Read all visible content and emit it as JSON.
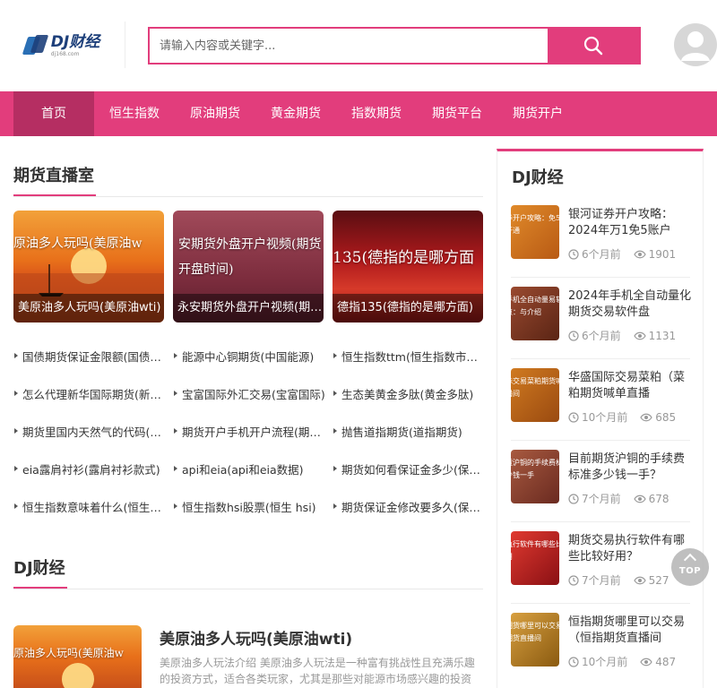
{
  "brand": {
    "logo_text": "DJ财经",
    "logo_sub": "dj168.com"
  },
  "search": {
    "placeholder": "请输入内容或关键字..."
  },
  "nav": [
    {
      "label": "首页",
      "active": true
    },
    {
      "label": "恒生指数"
    },
    {
      "label": "原油期货"
    },
    {
      "label": "黄金期货"
    },
    {
      "label": "指数期货"
    },
    {
      "label": "期货平台"
    },
    {
      "label": "期货开户"
    }
  ],
  "live": {
    "title": "期货直播室",
    "cards": [
      {
        "image_text": "原油多人玩吗(美原油w",
        "caption": "美原油多人玩吗(美原油wti)"
      },
      {
        "image_text": "安期货外盘开户视频(期货开盘时间)",
        "caption": "永安期货外盘开户视频(期货开盘时间)"
      },
      {
        "image_text": "135(德指的是哪方面",
        "caption": "德指135(德指的是哪方面)"
      }
    ],
    "links": [
      [
        "国债期货保证金限额(国债期货保证金)",
        "能源中心铜期货(中国能源)",
        "恒生指数ttm(恒生指数市盈率)"
      ],
      [
        "怎么代理新华国际期货(新华国际)",
        "宝富国际外汇交易(宝富国际)",
        "生态美黄金多肽(黄金多肽)"
      ],
      [
        "期货里国内天然气的代码(天然气)",
        "期货开户手机开户流程(期货开户)",
        "抛售道指期货(道指期货)"
      ],
      [
        "eia露肩衬衫(露肩衬衫款式)",
        "api和eia(api和eia数据)",
        "期货如何看保证金多少(保证金)"
      ],
      [
        "恒生指数意味着什么(恒生指数)",
        "恒生指数hsi股票(恒生 hsi)",
        "期货保证金修改要多久(保证金)"
      ]
    ]
  },
  "dj": {
    "title": "DJ财经",
    "featured": {
      "image_text": "原油多人玩吗(美原油w",
      "title": "美原油多人玩吗(美原油wti)",
      "desc": "美原油多人玩法介绍 美原油多人玩法是一种富有挑战性且充满乐趣的投资方式，适合各类玩家，尤其是那些对能源市场感兴趣的投资者。"
    }
  },
  "sidebar": {
    "title": "DJ财经",
    "items": [
      {
        "thumb_text": "券开户攻略：免5账户开通",
        "title": "银河证券开户攻略：2024年万1免5账户",
        "time": "6个月前",
        "views": "1901",
        "color": "#c8681a"
      },
      {
        "thumb_text": "手机全自动量易软件盘点：与介绍",
        "title": "2024年手机全自动量化期货交易软件盘",
        "time": "6个月前",
        "views": "1131",
        "color": "#7a3a22"
      },
      {
        "thumb_text": "际交易菜粕期货喊单直播间",
        "title": "华盛国际交易菜粕（菜粕期货喊单直播",
        "time": "10个月前",
        "views": "685",
        "color": "#b85a14"
      },
      {
        "thumb_text": "货沪铜的手续费标准多少钱一手",
        "title": "目前期货沪铜的手续费标准多少钱一手？",
        "time": "7个月前",
        "views": "678",
        "color": "#8a4030"
      },
      {
        "thumb_text": "执行软件有哪些比较好用",
        "title": "期货交易执行软件有哪些比较好用？",
        "time": "7个月前",
        "views": "527",
        "color": "#c2242a"
      },
      {
        "thumb_text": "期货哪里可以交易恒指期货直播间",
        "title": "恒指期货哪里可以交易（恒指期货直播间",
        "time": "10个月前",
        "views": "487",
        "color": "#b07818"
      }
    ]
  },
  "top_button": {
    "label": "TOP"
  }
}
